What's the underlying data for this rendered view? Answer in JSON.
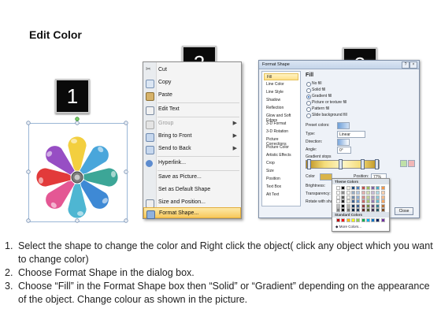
{
  "title": "Edit Color",
  "badges": [
    "1",
    "2",
    "3"
  ],
  "colors": {
    "petals": [
      "#f2cb2f",
      "#3a9fd9",
      "#2c9f8f",
      "#2e7fd2",
      "#3fb0cf",
      "#e2498c",
      "#e02a2a",
      "#8f3fbf"
    ]
  },
  "context_menu": {
    "items": [
      {
        "label": "Cut",
        "icon": "scissors-icon",
        "enabled": true,
        "submenu": false
      },
      {
        "label": "Copy",
        "icon": "copy-icon",
        "enabled": true,
        "submenu": false
      },
      {
        "label": "Paste",
        "icon": "paste-icon",
        "enabled": true,
        "submenu": false
      },
      {
        "label": "Edit Text",
        "icon": "edit-text-icon",
        "enabled": true,
        "submenu": false
      },
      {
        "label": "Group",
        "icon": "group-icon",
        "enabled": false,
        "submenu": true
      },
      {
        "label": "Bring to Front",
        "icon": "bring-front-icon",
        "enabled": true,
        "submenu": true
      },
      {
        "label": "Send to Back",
        "icon": "send-back-icon",
        "enabled": true,
        "submenu": true
      },
      {
        "label": "Hyperlink...",
        "icon": "hyperlink-icon",
        "enabled": true,
        "submenu": false
      },
      {
        "label": "Save as Picture...",
        "icon": "",
        "enabled": true,
        "submenu": false
      },
      {
        "label": "Set as Default Shape",
        "icon": "",
        "enabled": true,
        "submenu": false
      },
      {
        "label": "Size and Position...",
        "icon": "size-position-icon",
        "enabled": true,
        "submenu": false
      },
      {
        "label": "Format Shape...",
        "icon": "format-shape-icon",
        "enabled": true,
        "submenu": false,
        "highlighted": true
      }
    ]
  },
  "dialog": {
    "title": "Format Shape",
    "categories": [
      "Fill",
      "Line Color",
      "Line Style",
      "Shadow",
      "Reflection",
      "Glow and Soft Edges",
      "3-D Format",
      "3-D Rotation",
      "Picture Corrections",
      "Picture Color",
      "Artistic Effects",
      "Crop",
      "Size",
      "Position",
      "Text Box",
      "Alt Text"
    ],
    "selected_category": "Fill",
    "heading": "Fill",
    "fill_options": [
      "No fill",
      "Solid fill",
      "Gradient fill",
      "Picture or texture fill",
      "Pattern fill",
      "Slide background fill"
    ],
    "selected_fill": "Gradient fill",
    "labels": {
      "preset": "Preset colors:",
      "type": "Type:",
      "type_value": "Linear",
      "direction": "Direction:",
      "angle": "Angle:",
      "angle_value": "0°",
      "gradient_stops": "Gradient stops",
      "color": "Color",
      "position": "Position:",
      "position_value": "77%",
      "brightness": "Brightness:",
      "transparency": "Transparency:",
      "rotate": "Rotate with shape"
    },
    "close_label": "Close"
  },
  "palette": {
    "theme_header": "Theme Colors",
    "standard_header": "Standard Colors",
    "more": "More Colors...",
    "theme_top": [
      "#ffffff",
      "#000000",
      "#eeece1",
      "#1f497d",
      "#4f81bd",
      "#c0504d",
      "#9bbb59",
      "#8064a2",
      "#4bacc6",
      "#f79646"
    ],
    "standard": [
      "#c00000",
      "#ff0000",
      "#ffc000",
      "#ffff00",
      "#92d050",
      "#00b050",
      "#00b0f0",
      "#0070c0",
      "#002060",
      "#7030a0"
    ]
  },
  "steps": [
    {
      "n": "1.",
      "text": "Select the shape to change the color and Right click the object( click any object which you want to change color)"
    },
    {
      "n": "2.",
      "text": "Choose Format Shape in the dialog box."
    },
    {
      "n": "3.",
      "text": "Choose “Fill” in the Format Shape box then “Solid” or “Gradient” depending on the appearance of the object. Change colour as shown in the picture."
    }
  ]
}
